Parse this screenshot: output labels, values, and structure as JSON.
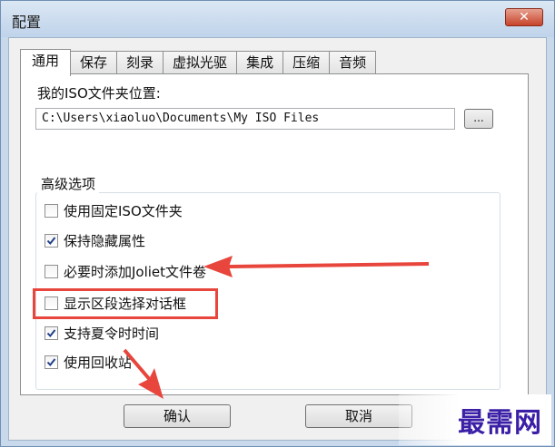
{
  "window": {
    "title": "配置",
    "close_glyph": "✕"
  },
  "tabs": [
    {
      "label": "通用",
      "active": true
    },
    {
      "label": "保存"
    },
    {
      "label": "刻录"
    },
    {
      "label": "虚拟光驱"
    },
    {
      "label": "集成"
    },
    {
      "label": "压缩"
    },
    {
      "label": "音频"
    }
  ],
  "folder": {
    "label": "我的ISO文件夹位置:",
    "path": "C:\\Users\\xiaoluo\\Documents\\My ISO Files",
    "browse_label": "..."
  },
  "advanced": {
    "title": "高级选项",
    "options": [
      {
        "label": "使用固定ISO文件夹",
        "checked": false
      },
      {
        "label": "保持隐藏属性",
        "checked": true
      },
      {
        "label": "必要时添加Joliet文件卷",
        "checked": false
      },
      {
        "label": "显示区段选择对话框",
        "checked": false
      },
      {
        "label": "支持夏令时时间",
        "checked": true
      },
      {
        "label": "使用回收站",
        "checked": true
      }
    ]
  },
  "buttons": {
    "ok": "确认",
    "cancel": "取消"
  },
  "watermark": {
    "text": "最需网"
  },
  "colors": {
    "annotation": "#e8453c",
    "watermark": "#3b1fa6"
  }
}
